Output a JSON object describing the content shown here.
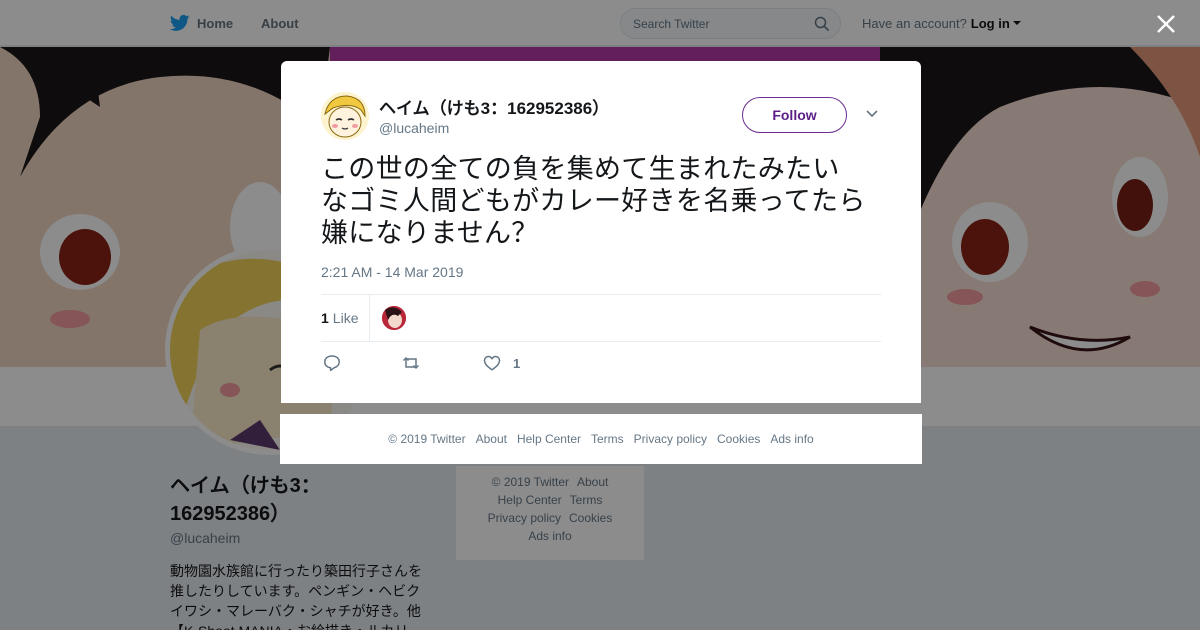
{
  "nav": {
    "home": "Home",
    "about": "About"
  },
  "search": {
    "placeholder": "Search Twitter"
  },
  "account": {
    "prompt": "Have an account?",
    "login": "Log in"
  },
  "profile": {
    "name": "ヘイム（けも3：162952386）",
    "handle": "@lucaheim",
    "bio_lines": [
      "動物園水族館に行ったり築田行子さんを",
      "推したりしています。ペンギン・ヘビク",
      "イワシ・マレーバク・シャチが好き。他",
      "【K-Shoot MANIA・お絵描き・ルカリ"
    ]
  },
  "side_footer": {
    "links": [
      "© 2019 Twitter",
      "About",
      "Help Center",
      "Terms",
      "Privacy policy",
      "Cookies",
      "Ads info"
    ]
  },
  "tweet": {
    "author_name": "ヘイム（けも3：162952386）",
    "author_handle": "@lucaheim",
    "follow_label": "Follow",
    "text_lines": [
      "この世の全ての負を集めて生まれたみたい",
      "なゴミ人間どもがカレー好きを名乗ってたら",
      "嫌になりません？"
    ],
    "timestamp": "2:21 AM - 14 Mar 2019",
    "likes_count": "1",
    "likes_label": "Like",
    "like_action_count": "1"
  },
  "footer": {
    "links": [
      "© 2019 Twitter",
      "About",
      "Help Center",
      "Terms",
      "Privacy policy",
      "Cookies",
      "Ads info"
    ]
  },
  "colors": {
    "twitter_blue": "#1da1f2",
    "follow_purple": "#5b1e86",
    "banner_pink": "#b43aa6"
  },
  "icons": [
    "twitter-bird-icon",
    "search-icon",
    "close-icon",
    "chevron-down-icon",
    "reply-icon",
    "retweet-icon",
    "heart-icon"
  ]
}
